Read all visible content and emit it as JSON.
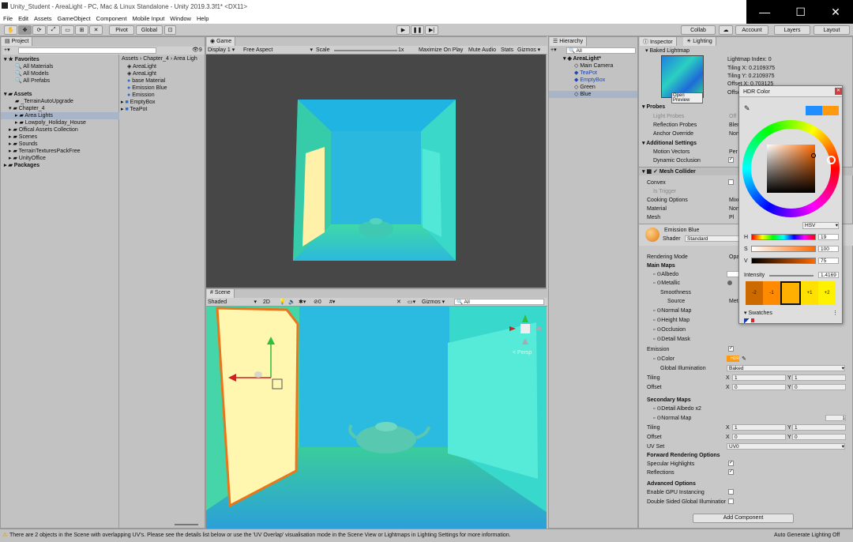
{
  "window": {
    "title": "Unity_Student - AreaLight - PC, Mac & Linux Standalone - Unity 2019.3.3f1* <DX11>",
    "minimize": "—",
    "maximize": "☐",
    "close": "✕"
  },
  "menu": [
    "File",
    "Edit",
    "Assets",
    "GameObject",
    "Component",
    "Mobile Input",
    "Window",
    "Help"
  ],
  "toolbar": {
    "pivot": "Pivot",
    "global": "Global",
    "collab": "Collab",
    "account": "Account",
    "layers": "Layers",
    "layout": "Layout"
  },
  "project": {
    "tab": "Project",
    "count": "9",
    "favorites": "Favorites",
    "fav_items": [
      "All Materials",
      "All Models",
      "All Prefabs"
    ],
    "assets": "Assets",
    "tree": [
      "_TerrainAutoUpgrade",
      "Chapter_4",
      "Area Lights",
      "Lowpoly_Holiday_House",
      "Offical Assets Collection",
      "Scenes",
      "Sounds",
      "TerrainTexturesPackFree",
      "UnityOffice"
    ],
    "packages": "Packages",
    "breadcrumb": "Assets › Chapter_4 › Area Ligh",
    "files": [
      "AreaLight",
      "AreaLight",
      "base Material",
      "Emission Blue",
      "Emission",
      "EmptyBox",
      "TeaPot"
    ]
  },
  "game": {
    "tab": "Game",
    "display": "Display 1",
    "aspect": "Free Aspect",
    "scale": "Scale",
    "scale_val": "1x",
    "maximize": "Maximize On Play",
    "mute": "Mute Audio",
    "stats": "Stats",
    "gizmos": "Gizmos"
  },
  "scene": {
    "tab": "Scene",
    "shading": "Shaded",
    "mode2d": "2D",
    "gizmos": "Gizmos",
    "search": "All",
    "persp": "< Persp"
  },
  "hierarchy": {
    "tab": "Hierarchy",
    "search": "All",
    "root": "AreaLight*",
    "items": [
      "Main Camera",
      "TeaPot",
      "EmptyBox",
      "Green",
      "Blue"
    ]
  },
  "inspector": {
    "tab": "Inspector",
    "lighting_tab": "Lighting",
    "baked_lightmap": "Baked Lightmap",
    "open_preview": "Open Preview",
    "lightmap_index": "Lightmap Index: 0",
    "tiling_x": "Tiling X: 0.2109375",
    "tiling_y": "Tiling Y: 0.2109375",
    "offset_x": "Offset X: 0.703125",
    "offset_y": "Offse",
    "probes": "Probes",
    "light_probes": "Light Probes",
    "light_probes_val": "Off",
    "reflection_probes": "Reflection Probes",
    "reflection_val": "Blen",
    "anchor_override": "Anchor Override",
    "anchor_val": "Non",
    "additional": "Additional Settings",
    "motion_vectors": "Motion Vectors",
    "motion_val": "Per",
    "dynamic_occlusion": "Dynamic Occlusion",
    "mesh_collider": "Mesh Collider",
    "convex": "Convex",
    "is_trigger": "Is Trigger",
    "cooking": "Cooking Options",
    "cooking_val": "Mixe",
    "material": "Material",
    "material_val": "Non",
    "mesh": "Mesh",
    "mesh_val": "Pl",
    "emission_mat": "Emission Blue",
    "shader": "Shader",
    "shader_val": "Standard",
    "rendering_mode": "Rendering Mode",
    "rendering_val": "Opa",
    "main_maps": "Main Maps",
    "albedo": "Albedo",
    "metallic": "Metallic",
    "smoothness": "Smoothness",
    "source": "Source",
    "source_val": "Met",
    "normal_map": "Normal Map",
    "height_map": "Height Map",
    "occlusion": "Occlusion",
    "detail_mask": "Detail Mask",
    "emission": "Emission",
    "color": "Color",
    "hdr": "HDR",
    "gi": "Global Illumination",
    "gi_val": "Baked",
    "tiling": "Tiling",
    "offset": "Offset",
    "x": "X",
    "y": "Y",
    "one": "1",
    "zero": "0",
    "secondary": "Secondary Maps",
    "detail_albedo": "Detail Albedo x2",
    "normal_map2": "Normal Map",
    "uv_set": "UV Set",
    "uv_val": "UV0",
    "forward": "Forward Rendering Options",
    "specular": "Specular Highlights",
    "reflections": "Reflections",
    "advanced": "Advanced Options",
    "gpu_instancing": "Enable GPU Instancing",
    "double_sided": "Double Sided Global Illuminatior",
    "add_component": "Add Component"
  },
  "hdr_color": {
    "title": "HDR Color",
    "mode": "HSV",
    "h_label": "H",
    "h": "19",
    "s_label": "S",
    "s": "100",
    "v_label": "V",
    "v": "75",
    "intensity_label": "Intensity",
    "intensity": "1.4169",
    "stops": [
      "-2",
      "-1",
      "",
      "+1",
      "+2"
    ],
    "swatches": "Swatches",
    "base_color": "#ff9a10",
    "prev_color": "#1f8fff"
  },
  "status": {
    "warning": "There are 2 objects in the Scene with overlapping UV's. Please see the details list below or use the 'UV Overlap' visualisation mode in the Scene View or Lightmaps in Lighting Settings for more information.",
    "auto_gen": "Auto Generate Lighting Off"
  }
}
